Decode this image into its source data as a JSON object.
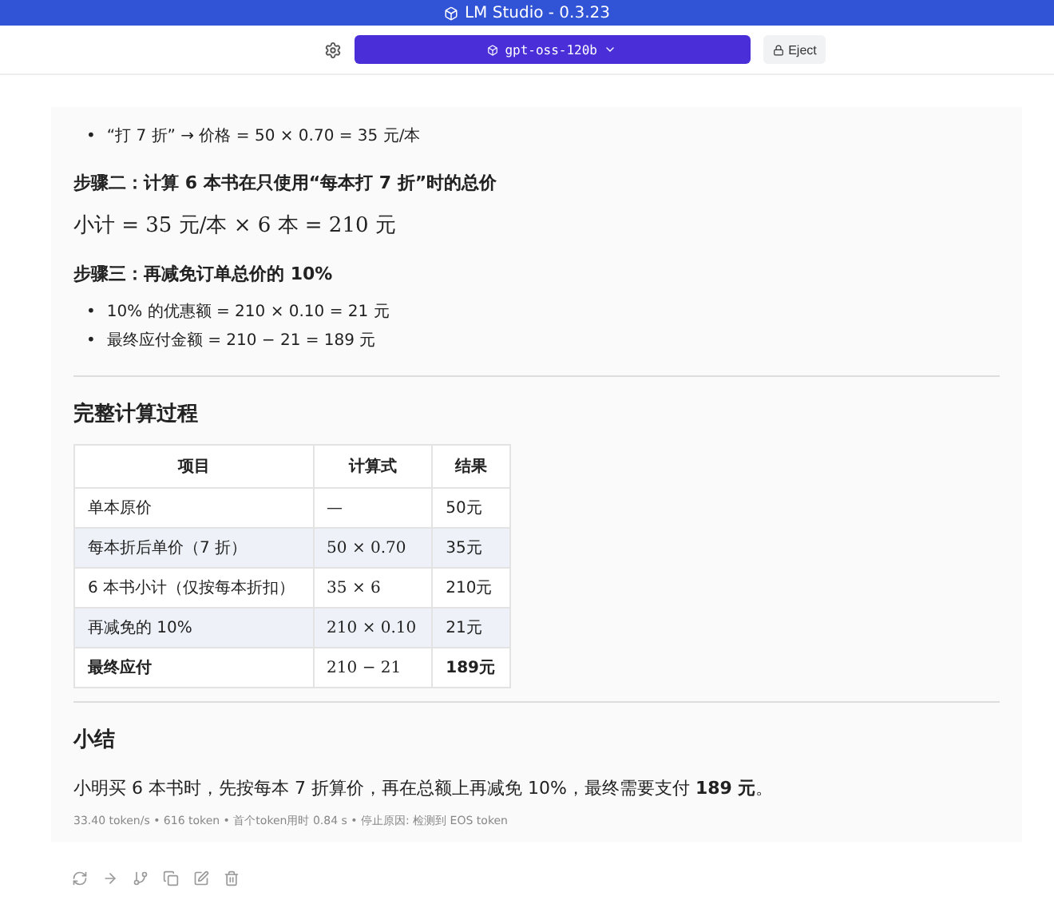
{
  "window": {
    "title": "LM Studio - 0.3.23"
  },
  "toolbar": {
    "model": "gpt-oss-120b",
    "eject": "Eject"
  },
  "message": {
    "top_bullets": [
      {
        "marker": "•",
        "text": "“打 7 折” → 价格 = 50 × 0.70 = 35 元/本"
      }
    ],
    "step2_heading": "步骤二：计算 6 本书在只使用“每本打 7 折”时的总价",
    "step2_formula": "小计 = 35 元/本 × 6 本 = 210 元",
    "step3_heading": "步骤三：再减免订单总价的 10%",
    "step3_bullets": [
      {
        "marker": "•",
        "text": "10% 的优惠额 = 210 × 0.10 = 21 元"
      },
      {
        "marker": "•",
        "text": "最终应付金额 = 210 − 21 = 189 元"
      }
    ],
    "section_heading": "完整计算过程",
    "table": {
      "columns": [
        "项目",
        "计算式",
        "结果"
      ],
      "rows": [
        {
          "cells": [
            "单本原价",
            "—",
            "50元"
          ],
          "bold": false
        },
        {
          "cells": [
            "每本折后单价（7 折）",
            "50 × 0.70",
            "35元"
          ],
          "bold": false
        },
        {
          "cells": [
            "6 本书小计（仅按每本折扣）",
            "35 × 6",
            "210元"
          ],
          "bold": false
        },
        {
          "cells": [
            "再减免的 10%",
            "210 × 0.10",
            "21元"
          ],
          "bold": false
        },
        {
          "cells": [
            "最终应付",
            "210 − 21",
            "189元"
          ],
          "bold": true
        }
      ]
    },
    "summary_heading": "小结",
    "summary_text": "小明买 6 本书时，先按每本 7 折算价，再在总额上再减免 10%，最终需要支付 **189 元**。",
    "stats": "33.40 token/s • 616 token • 首个token用时 0.84 s • 停止原因: 检测到 EOS token"
  }
}
